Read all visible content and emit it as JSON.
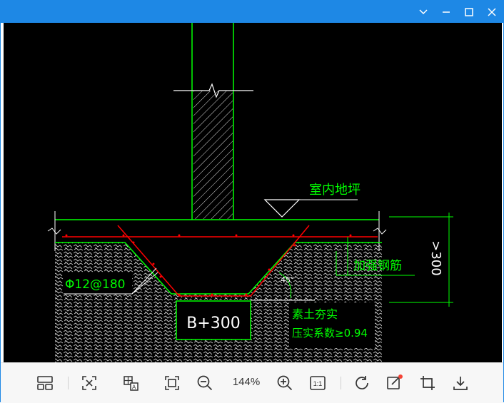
{
  "window": {
    "title": "",
    "controls": [
      "chevron-down-icon",
      "minimize-icon",
      "maximize-icon",
      "close-icon"
    ],
    "accent_color": "#1e88e5"
  },
  "drawing": {
    "background_color": "#000000",
    "label_indoor_floor": "室内地坪",
    "label_rebar": "Φ12@180",
    "label_anchor_rebar": "加强钢筋",
    "label_dim_300": ">300",
    "label_width": "B+300",
    "label_soil_line1": "素土夯实",
    "label_soil_line2": "压实系数≥0.94",
    "angle_mark": "45°",
    "colors": {
      "green": "#00ff00",
      "red": "#ff0000",
      "white": "#ffffff",
      "hatch": "#bdbdbd"
    }
  },
  "toolbar": {
    "zoom_level": "144%",
    "one_to_one": "1:1",
    "buttons": [
      "layout-icon",
      "fit-screen-icon",
      "ocr-icon",
      "fullscreen-icon",
      "zoom-out-icon",
      "zoom-in-icon",
      "actual-size-icon",
      "rotate-icon",
      "edit-icon",
      "crop-icon",
      "download-icon"
    ]
  }
}
